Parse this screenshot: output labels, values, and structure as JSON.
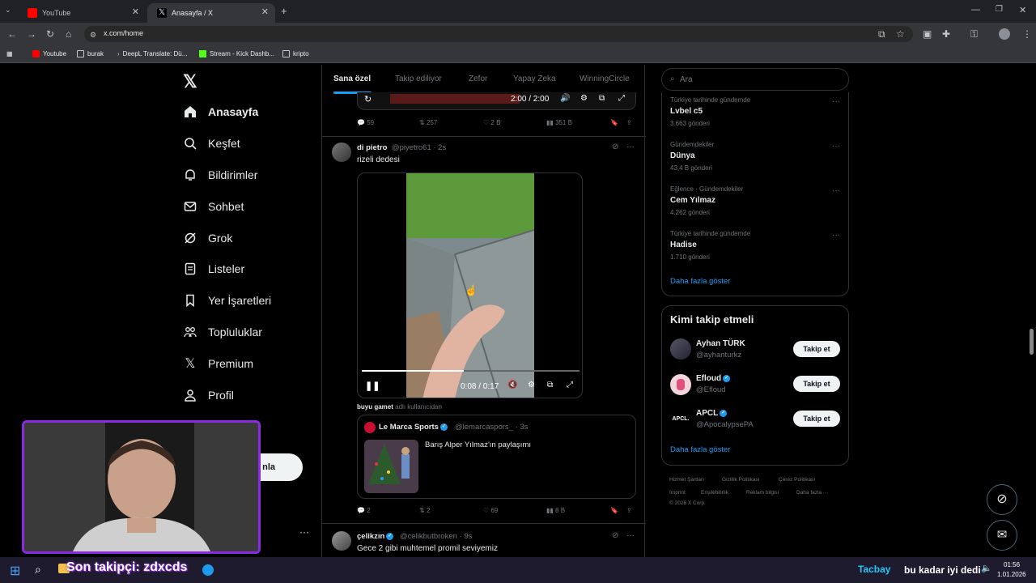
{
  "browser": {
    "tabs": [
      {
        "label": "YouTube",
        "active": false
      },
      {
        "label": "Anasayfa / X",
        "active": true
      }
    ],
    "url": "x.com/home",
    "bookmarks": [
      "Youtube",
      "burak",
      "DeepL Translate: Dü...",
      "Stream - Kick Dashb...",
      "kripto"
    ]
  },
  "sidebar": {
    "items": [
      {
        "label": "Anasayfa",
        "icon": "home-icon"
      },
      {
        "label": "Keşfet",
        "icon": "search-icon"
      },
      {
        "label": "Bildirimler",
        "icon": "bell-icon"
      },
      {
        "label": "Sohbet",
        "icon": "mail-icon"
      },
      {
        "label": "Grok",
        "icon": "grok-icon"
      },
      {
        "label": "Listeler",
        "icon": "list-icon"
      },
      {
        "label": "Yer İşaretleri",
        "icon": "bookmark-icon"
      },
      {
        "label": "Topluluklar",
        "icon": "communities-icon"
      },
      {
        "label": "Premium",
        "icon": "x-logo-icon"
      },
      {
        "label": "Profil",
        "icon": "profile-icon"
      }
    ],
    "post_button_partial": "nla",
    "more_dots": "···"
  },
  "feed": {
    "tabs": [
      "Sana özel",
      "Takip ediliyor",
      "Zefor",
      "Yapay Zeka",
      "WinningCircle"
    ],
    "prev_post": {
      "video_time": "2:00 / 2:00",
      "stats": {
        "replies": "59",
        "reposts": "257",
        "likes": "2 B",
        "views": "351 B"
      }
    },
    "post1": {
      "name": "di pietro",
      "handle": "@piyetro61 · 2s",
      "text": "rizeli dedesi",
      "video_time": "0:08 / 0:17",
      "video_progress": 0.47,
      "quote_header_user": "buyu gamet",
      "quote_header_suffix": "adlı kullanıcıdan",
      "quote": {
        "name": "Le Marca Sports",
        "handle": "@lemarcaspors_ · 3s",
        "text": "Barış Alper Yılmaz'ın paylaşımı"
      },
      "stats": {
        "replies": "2",
        "reposts": "2",
        "likes": "69",
        "views": "8 B"
      }
    },
    "post2": {
      "name": "çelikzın",
      "handle": "@celikbutbroken · 9s",
      "text": "Gece 2 gibi muhtemel promil seviyemiz"
    }
  },
  "right": {
    "search_placeholder": "Ara",
    "trends": [
      {
        "category": "Türkiye tarihinde gündemde",
        "name": "Lvbel c5",
        "count": "3.663 gönderi"
      },
      {
        "category": "Gündemdekiler",
        "name": "Dünya",
        "count": "43,4 B gönderi"
      },
      {
        "category": "Eğlence · Gündemdekiler",
        "name": "Cem Yılmaz",
        "count": "4.262 gönderi"
      },
      {
        "category": "Türkiye tarihinde gündemde",
        "name": "Hadise",
        "count": "1.710 gönderi"
      }
    ],
    "show_more": "Daha fazla göster",
    "who_to_follow_title": "Kimi takip etmeli",
    "who_to_follow": [
      {
        "name": "Ayhan TÜRK",
        "handle": "@ayhanturkz",
        "verified": false
      },
      {
        "name": "Efloud",
        "handle": "@Efloud",
        "verified": true
      },
      {
        "name": "APCL",
        "handle": "@ApocalypsePA",
        "verified": true,
        "logo": "APCL."
      }
    ],
    "follow_label": "Takip et",
    "show_more2": "Daha fazla göster",
    "footer": [
      "Hizmet Şartları",
      "Gizlilik Politikası",
      "Çerez Politikası",
      "Imprint",
      "Erişilebilirlik",
      "Reklam bilgisi",
      "Daha fazla ···",
      "© 2026 X Corp."
    ]
  },
  "overlay": {
    "follower_text": "Son takipçi: zdxcds",
    "donation_text": "bu kadar iyi dedi",
    "donation_user": "Tacbay"
  },
  "taskbar": {
    "time": "01:56",
    "date": "1.01.2026"
  },
  "colors": {
    "accent": "#1d9bf0",
    "stream_frame": "#8a2be2"
  }
}
